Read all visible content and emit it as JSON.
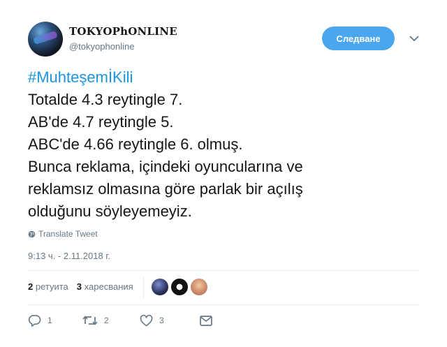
{
  "user": {
    "display_name": "TOKYOPhONLINE",
    "handle": "@tokyophonline"
  },
  "header": {
    "follow_label": "Следване"
  },
  "tweet": {
    "hashtag": "#MuhteşemİKili",
    "lines": [
      "Totalde 4.3 reytingle 7.",
      "AB'de 4.7 reytingle 5.",
      "ABC'de 4.66 reytingle 6. olmuş.",
      "Bunca reklama, içindeki oyuncularına ve",
      "reklamsız olmasına göre parlak bir açılış",
      "olduğunu söyleyemeyiz."
    ],
    "translate_label": "Translate Tweet",
    "timestamp": "9:13 ч. - 2.11.2018 г."
  },
  "stats": {
    "retweets_count": "2",
    "retweets_label": "ретуита",
    "likes_count": "3",
    "likes_label": "харесвания"
  },
  "actions": {
    "reply_count": "1",
    "retweet_count": "2",
    "like_count": "3"
  },
  "colors": {
    "accent": "#1b95e0",
    "follow_button": "#4aa7ee",
    "muted": "#657786",
    "text": "#14171a"
  },
  "icons": [
    "globe-icon",
    "chevron-down-icon",
    "reply-icon",
    "retweet-icon",
    "heart-icon",
    "message-icon"
  ]
}
